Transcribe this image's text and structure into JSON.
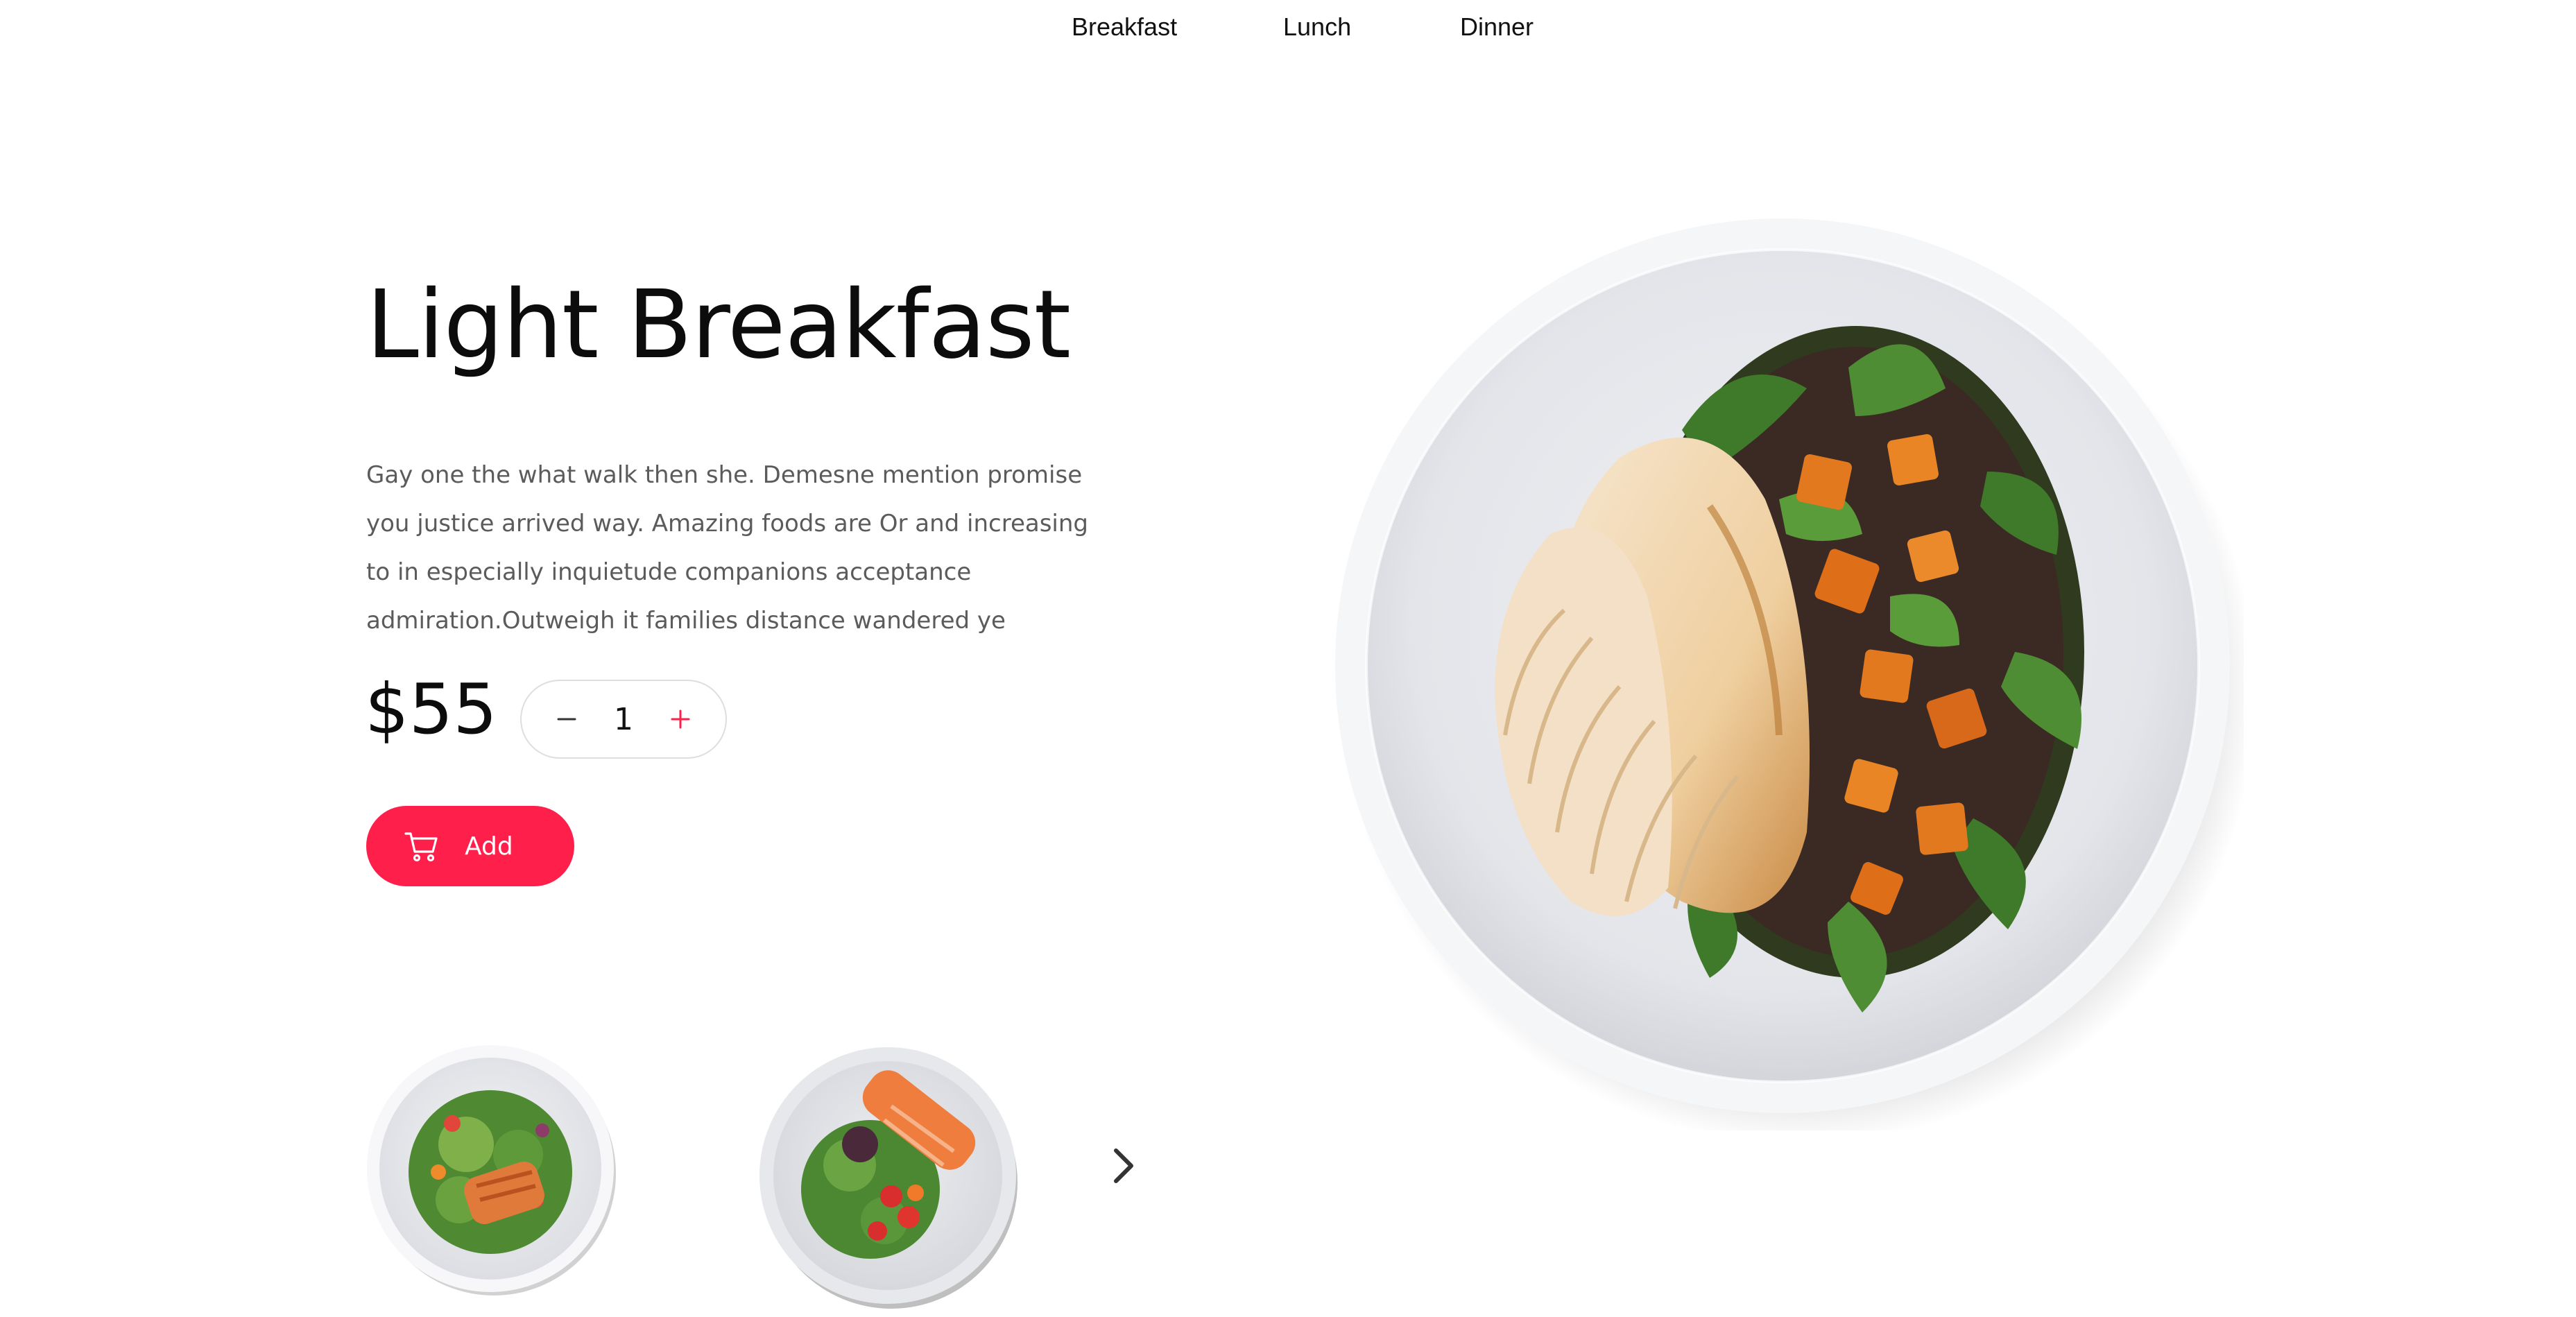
{
  "nav": {
    "items": [
      {
        "label": "Breakfast"
      },
      {
        "label": "Lunch"
      },
      {
        "label": "Dinner"
      }
    ]
  },
  "hero": {
    "title": "Light Breakfast",
    "description": "Gay one the what walk then she. Demesne mention promise you justice arrived way. Amazing foods are  Or and  increasing to in especially inquietude companions acceptance admiration.Outweigh it families distance wandered ye",
    "price": "$55"
  },
  "quantity": {
    "value": "1",
    "minus_symbol": "−",
    "plus_symbol": "+"
  },
  "cart": {
    "add_label": "Add"
  },
  "icons": {
    "cart": "cart-icon",
    "next": "chevron-right-icon",
    "minus": "minus-icon",
    "plus": "plus-icon"
  },
  "colors": {
    "accent": "#ff1f4b",
    "text": "#111111",
    "muted": "#5b5b5b",
    "border": "#dedede"
  }
}
